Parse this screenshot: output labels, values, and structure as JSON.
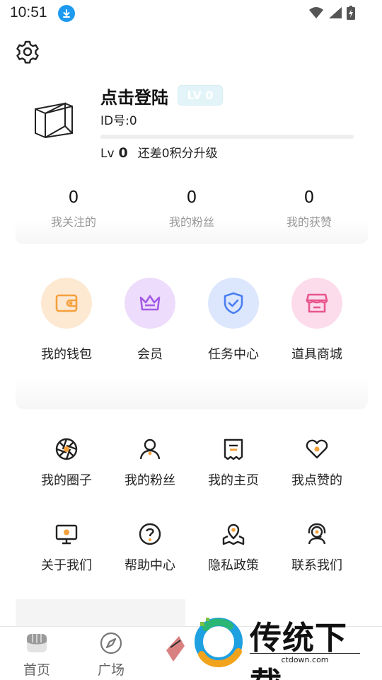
{
  "status_bar": {
    "time": "10:51",
    "icons": [
      "download-icon",
      "wifi-icon",
      "signal-icon",
      "battery-icon"
    ]
  },
  "header": {
    "settings_icon": "gear-icon"
  },
  "profile": {
    "name": "点击登陆",
    "level_badge": "LV 0",
    "id": "ID号:0",
    "level_prefix": "Lv",
    "level_num": "0",
    "level_hint": "还差0积分升级",
    "progress": 0
  },
  "stats": [
    {
      "value": "0",
      "label": "我关注的"
    },
    {
      "value": "0",
      "label": "我的粉丝"
    },
    {
      "value": "0",
      "label": "我的获赞"
    }
  ],
  "features": [
    {
      "label": "我的钱包",
      "icon": "wallet-icon",
      "bg": "#fde8d2",
      "color": "#f5a13c"
    },
    {
      "label": "会员",
      "icon": "crown-icon",
      "bg": "#eddcfb",
      "color": "#a35be6"
    },
    {
      "label": "任务中心",
      "icon": "shield-check-icon",
      "bg": "#dce7fd",
      "color": "#4a7ef0"
    },
    {
      "label": "道具商城",
      "icon": "store-icon",
      "bg": "#fcdcea",
      "color": "#e8568f"
    }
  ],
  "menu": [
    {
      "label": "我的圈子",
      "icon": "aperture-icon"
    },
    {
      "label": "我的粉丝",
      "icon": "user-icon"
    },
    {
      "label": "我的主页",
      "icon": "homepage-icon"
    },
    {
      "label": "我点赞的",
      "icon": "heart-icon"
    },
    {
      "label": "关于我们",
      "icon": "monitor-icon"
    },
    {
      "label": "帮助中心",
      "icon": "help-icon"
    },
    {
      "label": "隐私政策",
      "icon": "map-pin-icon"
    },
    {
      "label": "联系我们",
      "icon": "headset-icon"
    }
  ],
  "tabbar": [
    {
      "label": "首页",
      "icon": "home-store-icon"
    },
    {
      "label": "广场",
      "icon": "compass-icon"
    }
  ],
  "watermark": {
    "title": "传统下载",
    "url": "ctdown.com"
  },
  "colors": {
    "accent_orange": "#f5a13c",
    "text": "#222222",
    "muted": "#999999"
  }
}
